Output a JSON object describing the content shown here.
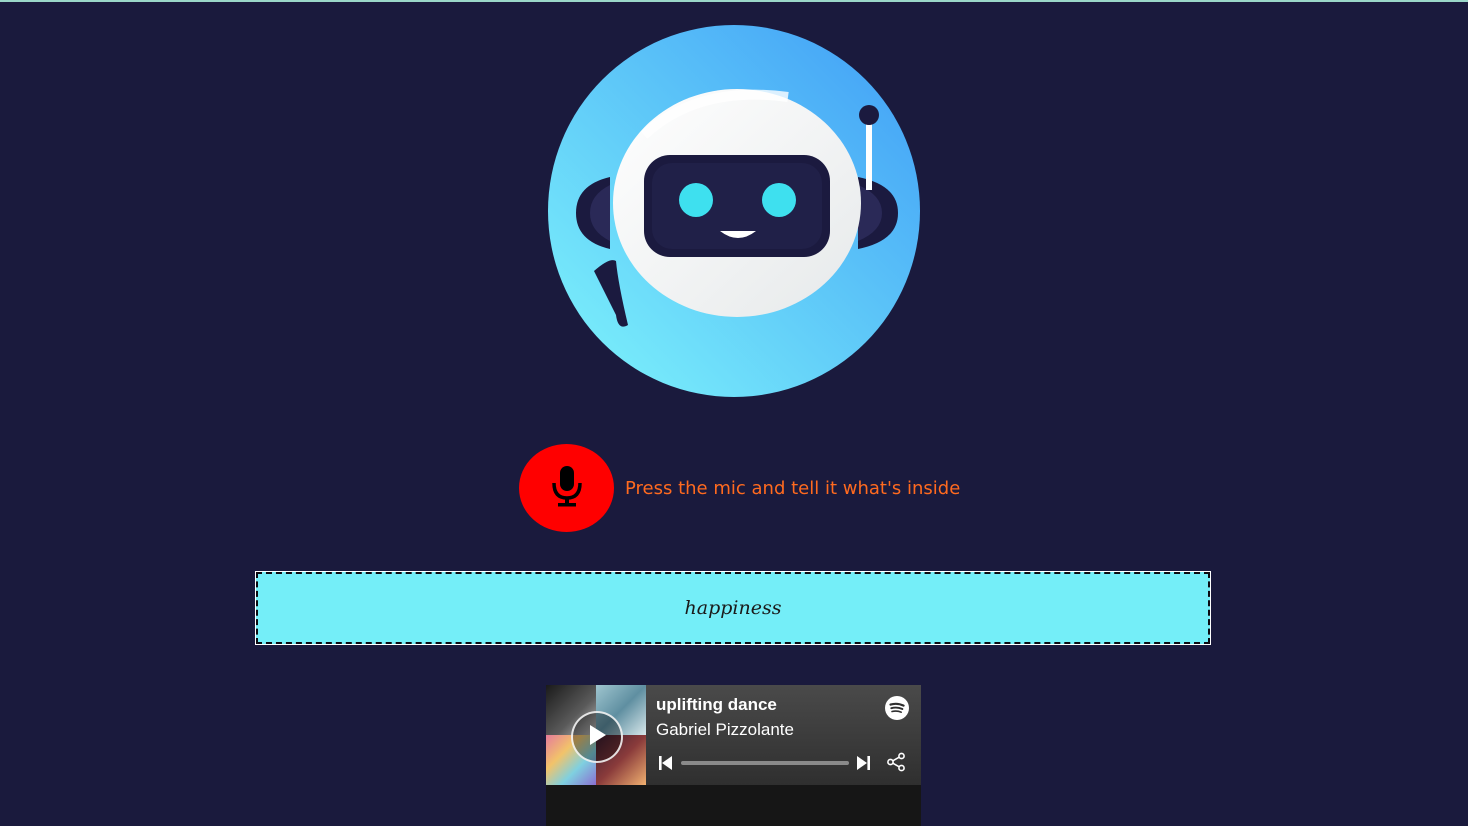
{
  "mic": {
    "hint": "Press the mic and tell it what's inside",
    "icon": "microphone-icon",
    "color": "#ff0000"
  },
  "robot": {
    "icon": "robot-logo"
  },
  "mood": {
    "text": "happiness"
  },
  "player": {
    "playlist_title": "uplifting dance",
    "artist": "Gabriel Pizzolante",
    "progress": 0.0,
    "icons": {
      "play": "play-icon",
      "previous": "skip-previous-icon",
      "next": "skip-next-icon",
      "share": "share-icon",
      "brand": "spotify-icon"
    }
  },
  "colors": {
    "background": "#1a1a3d",
    "accent_text": "#ff6a1f",
    "mood_box": "#74eef8"
  }
}
